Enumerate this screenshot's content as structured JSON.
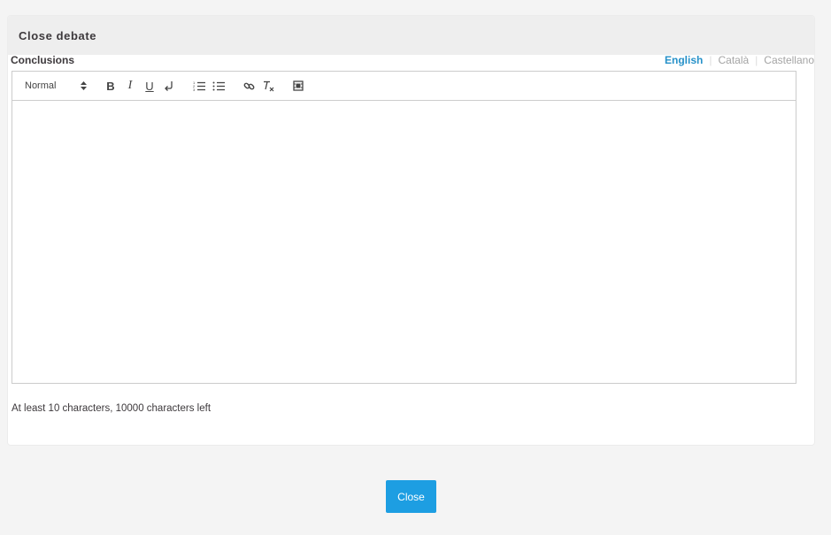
{
  "card": {
    "title": "Close debate"
  },
  "field": {
    "label": "Conclusions",
    "helper": "At least 10 characters, 10000 characters left"
  },
  "languages": {
    "tabs": [
      "English",
      "Català",
      "Castellano"
    ],
    "active": "English"
  },
  "toolbar": {
    "format_picker": "Normal",
    "buttons": [
      "bold",
      "italic",
      "underline",
      "linebreak",
      "ordered-list",
      "bullet-list",
      "link",
      "clear-format",
      "video"
    ],
    "bold_label": "B",
    "italic_label": "I",
    "underline_label": "U"
  },
  "editor": {
    "content": ""
  },
  "actions": {
    "close_label": "Close"
  },
  "colors": {
    "accent": "#1d9ee2",
    "active_tab": "#2691c9",
    "header_bg": "#eeeeee"
  }
}
